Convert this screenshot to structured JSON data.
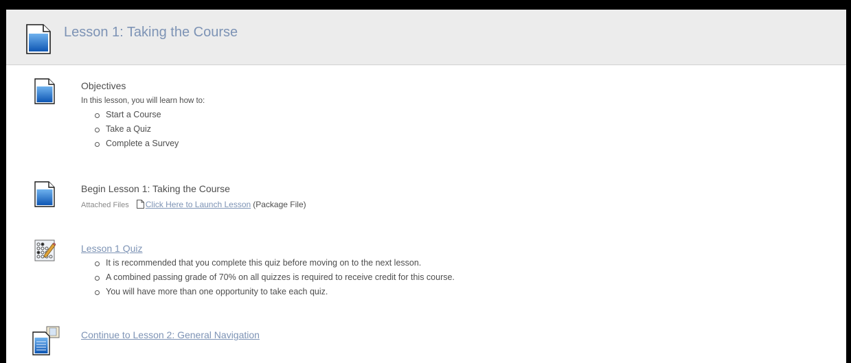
{
  "header": {
    "title": "Lesson 1: Taking the Course",
    "icon": "document-icon"
  },
  "colors": {
    "accent": "#7d93b5",
    "header_bg": "#ececec",
    "text": "#4d4d4d"
  },
  "items": [
    {
      "icon": "document-icon",
      "title": "Objectives",
      "intro": "In this lesson, you will learn how to:",
      "bullets": [
        "Start a Course",
        "Take a Quiz",
        "Complete a Survey"
      ]
    },
    {
      "icon": "document-icon",
      "title": "Begin Lesson 1: Taking the Course",
      "attached_label": "Attached Files",
      "file_link": "Click Here to Launch Lesson",
      "file_type": "(Package File)"
    },
    {
      "icon": "quiz-icon",
      "title": "Lesson 1 Quiz",
      "bullets": [
        "It is recommended that you complete this quiz before moving on to the next lesson.",
        "A combined passing grade of 70% on all quizzes is required to receive credit for this course.",
        "You will have more than one opportunity to take each quiz."
      ]
    },
    {
      "icon": "lesson-link-icon",
      "title": "Continue to Lesson 2: General Navigation"
    }
  ]
}
